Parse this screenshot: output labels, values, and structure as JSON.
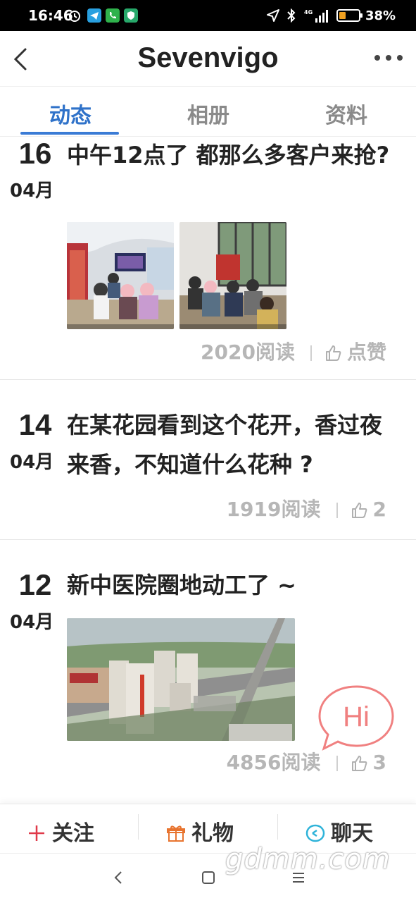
{
  "status_bar": {
    "time": "16:46",
    "battery_percent": "38%",
    "network": "4G",
    "battery_level": 0.38
  },
  "header": {
    "title": "Sevenvigo",
    "back_icon": "chevron-left-icon",
    "more_icon": "more-dots-icon"
  },
  "tabs": [
    {
      "label": "动态",
      "active": true
    },
    {
      "label": "相册",
      "active": false
    },
    {
      "label": "资料",
      "active": false
    }
  ],
  "posts": [
    {
      "day": "16",
      "month": "04月",
      "title": "中午12点了 都那么多客户来抢?",
      "reads": "2020阅读",
      "likes": "点赞",
      "photos": 2
    },
    {
      "day": "14",
      "month": "04月",
      "title": "在某花园看到这个花开，香过夜来香，不知道什么花种 ?",
      "reads": "1919阅读",
      "likes": "2",
      "photos": 0
    },
    {
      "day": "12",
      "month": "04月",
      "title": "新中医院圈地动工了 ~",
      "reads": "4856阅读",
      "likes": "3",
      "photos": 1
    }
  ],
  "hi_badge": "Hi",
  "bottom_bar": {
    "follow": "关注",
    "gift": "礼物",
    "chat": "聊天"
  },
  "watermark": "gdmm.com",
  "colors": {
    "accent": "#3a7bd5",
    "follow_plus": "#e03a4a",
    "gift": "#e8742f",
    "chat": "#2fb3d9",
    "hi": "#f08080"
  }
}
